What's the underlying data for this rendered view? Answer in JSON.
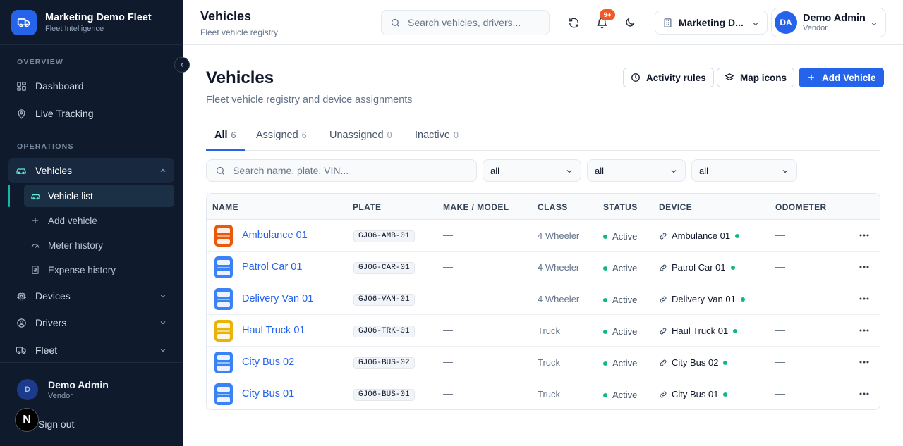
{
  "brand": {
    "title": "Marketing Demo Fleet",
    "subtitle": "Fleet Intelligence"
  },
  "sidebar": {
    "sections": [
      "OVERVIEW",
      "OPERATIONS"
    ],
    "items": [
      {
        "label": "Dashboard"
      },
      {
        "label": "Live Tracking"
      },
      {
        "label": "Vehicles"
      },
      {
        "label": "Devices"
      },
      {
        "label": "Drivers"
      },
      {
        "label": "Fleet"
      }
    ],
    "subitems": [
      {
        "label": "Vehicle list"
      },
      {
        "label": "Add vehicle"
      },
      {
        "label": "Meter history"
      },
      {
        "label": "Expense history"
      }
    ],
    "user": {
      "initial": "D",
      "name": "Demo Admin",
      "role": "Vendor"
    },
    "signout": "Sign out",
    "n_badge": "N"
  },
  "header": {
    "title": "Vehicles",
    "subtitle": "Fleet vehicle registry",
    "search_placeholder": "Search vehicles, drivers...",
    "notif_count": "9+",
    "tenant": "Marketing D...",
    "user": {
      "initials": "DA",
      "name": "Demo Admin",
      "role": "Vendor"
    }
  },
  "page": {
    "title": "Vehicles",
    "subtitle": "Fleet vehicle registry and device assignments",
    "buttons": {
      "activity_rules": "Activity rules",
      "map_icons": "Map icons",
      "add_vehicle": "Add Vehicle"
    },
    "tabs": [
      {
        "label": "All",
        "count": "6"
      },
      {
        "label": "Assigned",
        "count": "6"
      },
      {
        "label": "Unassigned",
        "count": "0"
      },
      {
        "label": "Inactive",
        "count": "0"
      }
    ],
    "filter_search_placeholder": "Search name, plate, VIN...",
    "filters": [
      "all",
      "all",
      "all"
    ]
  },
  "table": {
    "columns": [
      "NAME",
      "PLATE",
      "MAKE / MODEL",
      "CLASS",
      "STATUS",
      "DEVICE",
      "ODOMETER"
    ],
    "rows": [
      {
        "name": "Ambulance 01",
        "plate": "GJ06-AMB-01",
        "make": "—",
        "class": "4 Wheeler",
        "status": "Active",
        "device": "Ambulance 01",
        "odometer": "—",
        "color": "#ea580c"
      },
      {
        "name": "Patrol Car 01",
        "plate": "GJ06-CAR-01",
        "make": "—",
        "class": "4 Wheeler",
        "status": "Active",
        "device": "Patrol Car 01",
        "odometer": "—",
        "color": "#3b82f6"
      },
      {
        "name": "Delivery Van 01",
        "plate": "GJ06-VAN-01",
        "make": "—",
        "class": "4 Wheeler",
        "status": "Active",
        "device": "Delivery Van 01",
        "odometer": "—",
        "color": "#3b82f6"
      },
      {
        "name": "Haul Truck 01",
        "plate": "GJ06-TRK-01",
        "make": "—",
        "class": "Truck",
        "status": "Active",
        "device": "Haul Truck 01",
        "odometer": "—",
        "color": "#eab308"
      },
      {
        "name": "City Bus 02",
        "plate": "GJ06-BUS-02",
        "make": "—",
        "class": "Truck",
        "status": "Active",
        "device": "City Bus 02",
        "odometer": "—",
        "color": "#3b82f6"
      },
      {
        "name": "City Bus 01",
        "plate": "GJ06-BUS-01",
        "make": "—",
        "class": "Truck",
        "status": "Active",
        "device": "City Bus 01",
        "odometer": "—",
        "color": "#3b82f6"
      }
    ]
  },
  "colors": {
    "accent": "#2563eb",
    "sidebar_bg": "#0f1b2d",
    "active_green": "#10b981",
    "notif": "#f05a2b"
  }
}
